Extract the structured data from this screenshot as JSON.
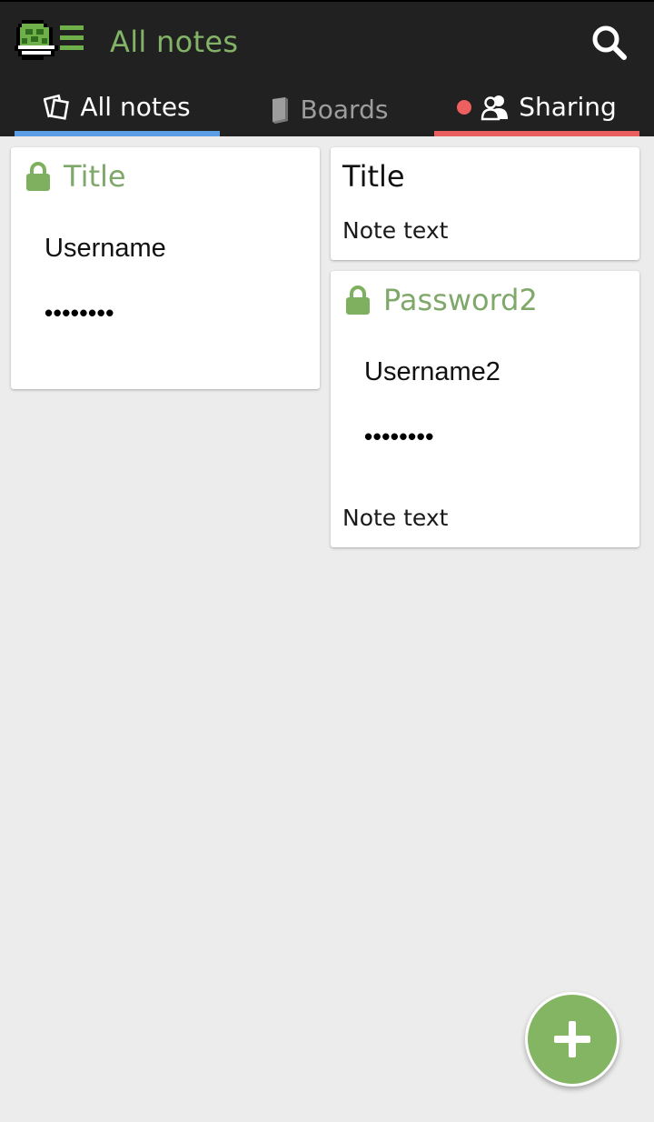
{
  "app": {
    "title": "All notes",
    "accent_color": "#83b366",
    "icons": {
      "logo": "turtle-shell-menu-logo",
      "search": "search-icon",
      "add": "plus-icon"
    }
  },
  "tabs": [
    {
      "label": "All notes",
      "icon": "notes-stack-icon",
      "selected": true,
      "indicator_color": "#5b9ee6"
    },
    {
      "label": "Boards",
      "icon": "book-icon",
      "selected": false
    },
    {
      "label": "Sharing",
      "icon": "users-icon",
      "selected": false,
      "indicator_color": "#e95f5f",
      "has_notification_dot": true
    }
  ],
  "notes": [
    {
      "title": "Title",
      "locked": true,
      "username": "Username",
      "password_mask": "••••••••"
    },
    {
      "title": "Title",
      "locked": false,
      "text": "Note text"
    },
    {
      "title": "Password2",
      "locked": true,
      "username": "Username2",
      "password_mask": "••••••••",
      "text": "Note text"
    }
  ]
}
